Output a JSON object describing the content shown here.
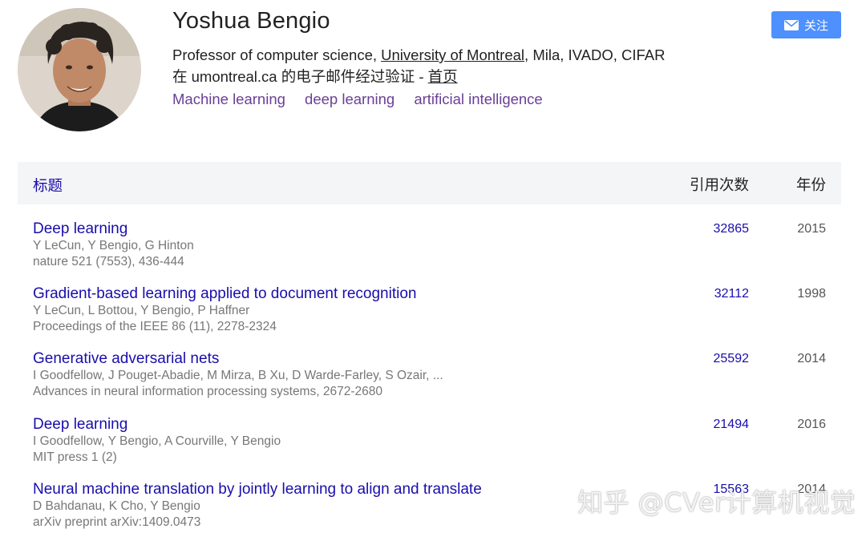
{
  "profile": {
    "name": "Yoshua Bengio",
    "affiliation_prefix": "Professor of computer science, ",
    "affiliation_link": "University of Montreal",
    "affiliation_suffix": ", Mila, IVADO, CIFAR",
    "email_text": "在 umontreal.ca 的电子邮件经过验证 - ",
    "homepage_label": "首页",
    "interests": [
      "Machine learning",
      "deep learning",
      "artificial intelligence"
    ],
    "follow_label": "关注"
  },
  "table": {
    "header": {
      "title": "标题",
      "cites": "引用次数",
      "year": "年份"
    },
    "rows": [
      {
        "title": "Deep learning",
        "authors": "Y LeCun, Y Bengio, G Hinton",
        "venue": "nature 521 (7553), 436-444",
        "cites": "32865",
        "year": "2015"
      },
      {
        "title": "Gradient-based learning applied to document recognition",
        "authors": "Y LeCun, L Bottou, Y Bengio, P Haffner",
        "venue": "Proceedings of the IEEE 86 (11), 2278-2324",
        "cites": "32112",
        "year": "1998"
      },
      {
        "title": "Generative adversarial nets",
        "authors": "I Goodfellow, J Pouget-Abadie, M Mirza, B Xu, D Warde-Farley, S Ozair, ...",
        "venue": "Advances in neural information processing systems, 2672-2680",
        "cites": "25592",
        "year": "2014"
      },
      {
        "title": "Deep learning",
        "authors": "I Goodfellow, Y Bengio, A Courville, Y Bengio",
        "venue": "MIT press 1 (2)",
        "cites": "21494",
        "year": "2016"
      },
      {
        "title": "Neural machine translation by jointly learning to align and translate",
        "authors": "D Bahdanau, K Cho, Y Bengio",
        "venue": "arXiv preprint arXiv:1409.0473",
        "cites": "15563",
        "year": "2014"
      }
    ]
  },
  "watermark": "知乎 @CVer计算机视觉",
  "colors": {
    "accent": "#4d90fe",
    "link": "#1a0dab",
    "interest": "#6a3f96",
    "meta": "#777777",
    "header_bg": "#f4f5f7"
  },
  "icons": {
    "follow": "envelope-icon"
  }
}
